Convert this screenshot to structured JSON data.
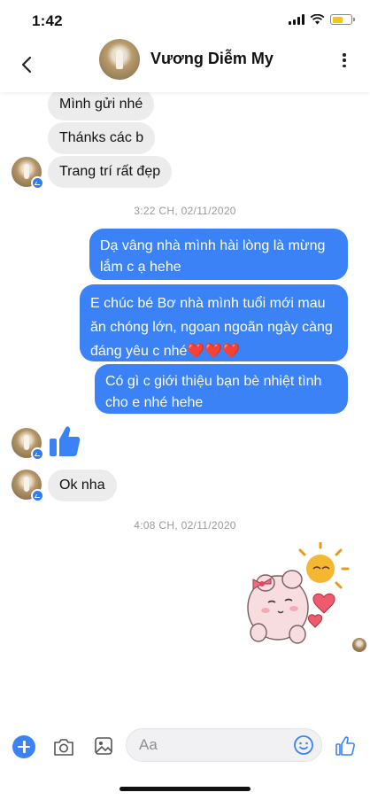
{
  "status_bar": {
    "time": "1:42",
    "battery_color": "#f5c518"
  },
  "header": {
    "contact_name": "Vương Diễm My",
    "back_icon": "chevron-left-icon",
    "menu_icon": "more-vertical-icon"
  },
  "messages": {
    "in_1": "Mình gửi nhé",
    "in_2": "Thánks các b",
    "in_3": "Trang trí rất đẹp",
    "time_1": "3:22 CH, 02/11/2020",
    "out_1": "Dạ vâng nhà mình hài lòng là mừng lắm c ạ hehe",
    "out_2": "E chúc bé Bơ nhà mình tuổi mới mau ăn chóng lớn, ngoan ngoãn ngày càng đáng yêu c nhé❤️❤️❤️",
    "out_3": "Có gì c giới thiệu bạn bè nhiệt tình cho e nhé hehe",
    "in_4": "Ok nha",
    "time_2": "4:08 CH, 02/11/2020"
  },
  "composer": {
    "placeholder": "Aa"
  },
  "colors": {
    "accent": "#3b82f6",
    "incoming_bubble": "#ececec"
  }
}
